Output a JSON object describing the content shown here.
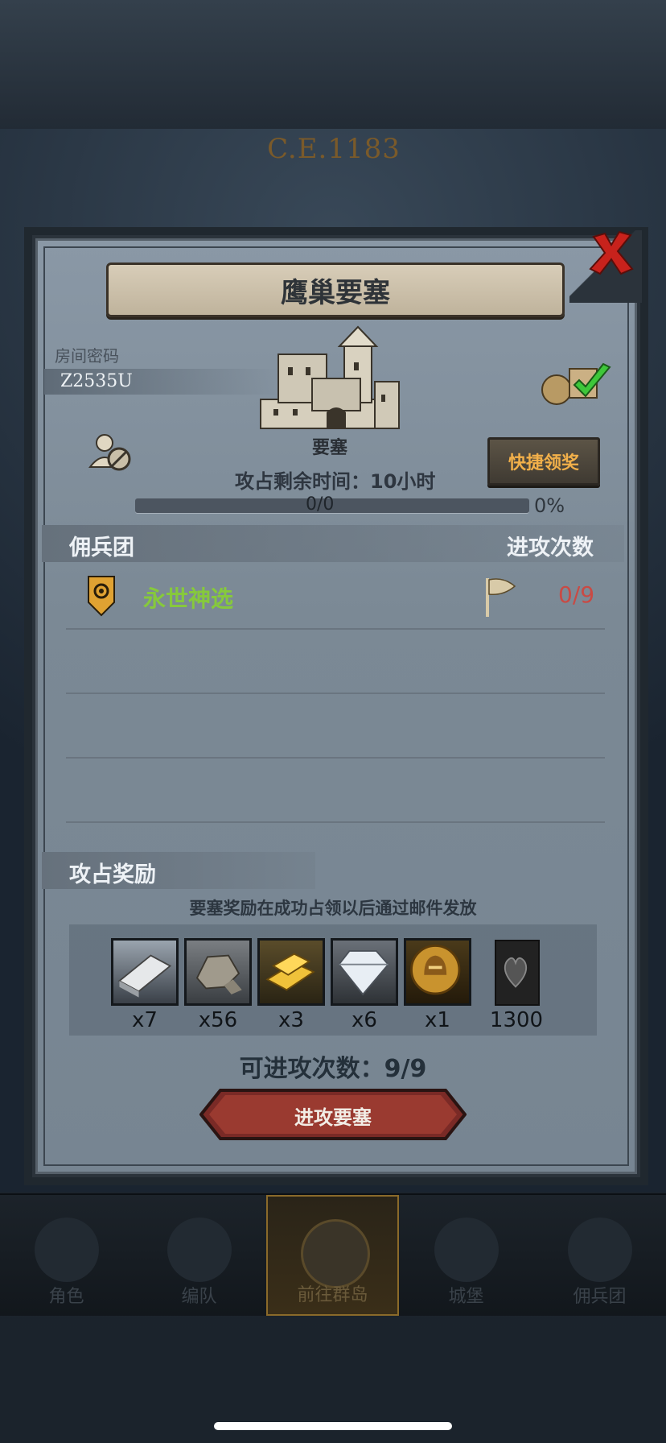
{
  "era": "C.E.1183",
  "dialog": {
    "title": "鹰巢要塞",
    "room_label": "房间密码",
    "room_code": "Z2535U",
    "fortress_label": "要塞",
    "quick_claim": "快捷领奖",
    "remaining_time": "攻占剩余时间：10小时",
    "progress_text": "0/0",
    "progress_percent": "0%",
    "progress_fraction": 0,
    "mercenary_header": "佣兵团",
    "attack_count_header": "进攻次数",
    "guilds": [
      {
        "name": "永世神选",
        "attacks": "0/9",
        "name_color": "#86c93c"
      }
    ],
    "rewards_header": "攻占奖励",
    "reward_note": "要塞奖励在成功占领以后通过邮件发放",
    "rewards": [
      {
        "icon": "silver-ingot-icon",
        "qty": "x7"
      },
      {
        "icon": "ore-icon",
        "qty": "x56"
      },
      {
        "icon": "gold-bars-icon",
        "qty": "x3"
      },
      {
        "icon": "diamond-icon",
        "qty": "x6"
      },
      {
        "icon": "knight-medal-icon",
        "qty": "x1"
      },
      {
        "icon": "heart-totem-icon",
        "qty": "1300"
      }
    ],
    "attacks_left": "可进攻次数：9/9",
    "attack_button": "进攻要塞"
  },
  "bottom_nav": [
    {
      "label": "角色",
      "icon": "character-icon",
      "active": false
    },
    {
      "label": "编队",
      "icon": "formation-icon",
      "active": false
    },
    {
      "label": "前往群岛",
      "icon": "islands-icon",
      "active": true
    },
    {
      "label": "城堡",
      "icon": "castle-icon",
      "active": false
    },
    {
      "label": "佣兵团",
      "icon": "mercenary-icon",
      "active": false
    }
  ],
  "colors": {
    "accent_gold": "#f2b04a",
    "guild_green": "#86c93c",
    "attack_red": "#c94a44"
  }
}
